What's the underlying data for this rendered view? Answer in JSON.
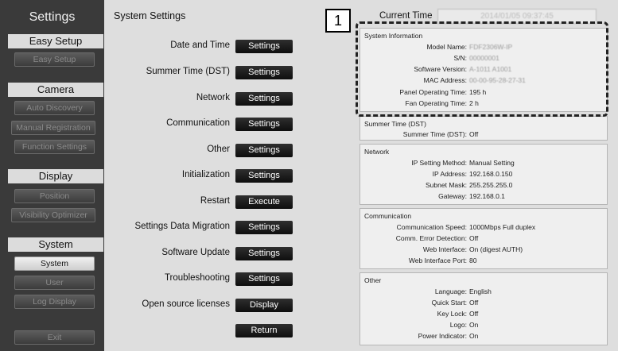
{
  "sidebar": {
    "title": "Settings",
    "sections": [
      {
        "header": "Easy Setup",
        "items": [
          {
            "label": "Easy Setup",
            "active": false
          }
        ]
      },
      {
        "header": "Camera",
        "items": [
          {
            "label": "Auto Discovery",
            "active": false
          },
          {
            "label": "Manual Registration",
            "active": false
          },
          {
            "label": "Function Settings",
            "active": false
          }
        ]
      },
      {
        "header": "Display",
        "items": [
          {
            "label": "Position",
            "active": false
          },
          {
            "label": "Visibility Optimizer",
            "active": false
          }
        ]
      },
      {
        "header": "System",
        "items": [
          {
            "label": "System",
            "active": true
          },
          {
            "label": "User",
            "active": false
          },
          {
            "label": "Log Display",
            "active": false
          }
        ]
      }
    ],
    "exit_label": "Exit"
  },
  "main": {
    "title": "System Settings",
    "rows": [
      {
        "label": "Date and Time",
        "button": "Settings"
      },
      {
        "label": "Summer Time (DST)",
        "button": "Settings"
      },
      {
        "label": "Network",
        "button": "Settings"
      },
      {
        "label": "Communication",
        "button": "Settings"
      },
      {
        "label": "Other",
        "button": "Settings"
      },
      {
        "label": "Initialization",
        "button": "Settings"
      },
      {
        "label": "Restart",
        "button": "Execute"
      },
      {
        "label": "Settings Data Migration",
        "button": "Settings"
      },
      {
        "label": "Software Update",
        "button": "Settings"
      },
      {
        "label": "Troubleshooting",
        "button": "Settings"
      },
      {
        "label": "Open source licenses",
        "button": "Display"
      }
    ],
    "return_label": "Return"
  },
  "current_time": {
    "label": "Current Time",
    "value": "2014/01/05 09:37:45"
  },
  "callout": {
    "number": "1"
  },
  "panels": {
    "system_information": {
      "title": "System Information",
      "rows": [
        {
          "key": "Model Name:",
          "value": "FDF2306W-IP",
          "blurred": true
        },
        {
          "key": "S/N:",
          "value": "00000001",
          "blurred": true
        },
        {
          "key": "Software Version:",
          "value": "A-1011 A1001",
          "blurred": true
        },
        {
          "key": "MAC Address:",
          "value": "00-00-95-28-27-31",
          "blurred": true
        },
        {
          "key": "Panel Operating Time:",
          "value": "195 h",
          "blurred": false
        },
        {
          "key": "Fan Operating Time:",
          "value": "2 h",
          "blurred": false
        }
      ]
    },
    "summer_time": {
      "title": "Summer Time (DST)",
      "rows": [
        {
          "key": "Summer Time (DST):",
          "value": "Off"
        }
      ]
    },
    "network": {
      "title": "Network",
      "rows": [
        {
          "key": "IP Setting Method:",
          "value": "Manual Setting"
        },
        {
          "key": "IP Address:",
          "value": "192.168.0.150"
        },
        {
          "key": "Subnet Mask:",
          "value": "255.255.255.0"
        },
        {
          "key": "Gateway:",
          "value": "192.168.0.1"
        }
      ]
    },
    "communication": {
      "title": "Communication",
      "rows": [
        {
          "key": "Communication Speed:",
          "value": "1000Mbps Full duplex"
        },
        {
          "key": "Comm. Error Detection:",
          "value": "Off"
        },
        {
          "key": "Web Interface:",
          "value": "On (digest AUTH)"
        },
        {
          "key": "Web Interface Port:",
          "value": "80"
        }
      ]
    },
    "other": {
      "title": "Other",
      "rows": [
        {
          "key": "Language:",
          "value": "English"
        },
        {
          "key": "Quick Start:",
          "value": "Off"
        },
        {
          "key": "Key Lock:",
          "value": "Off"
        },
        {
          "key": "Logo:",
          "value": "On"
        },
        {
          "key": "Power Indicator:",
          "value": "On"
        }
      ]
    }
  }
}
